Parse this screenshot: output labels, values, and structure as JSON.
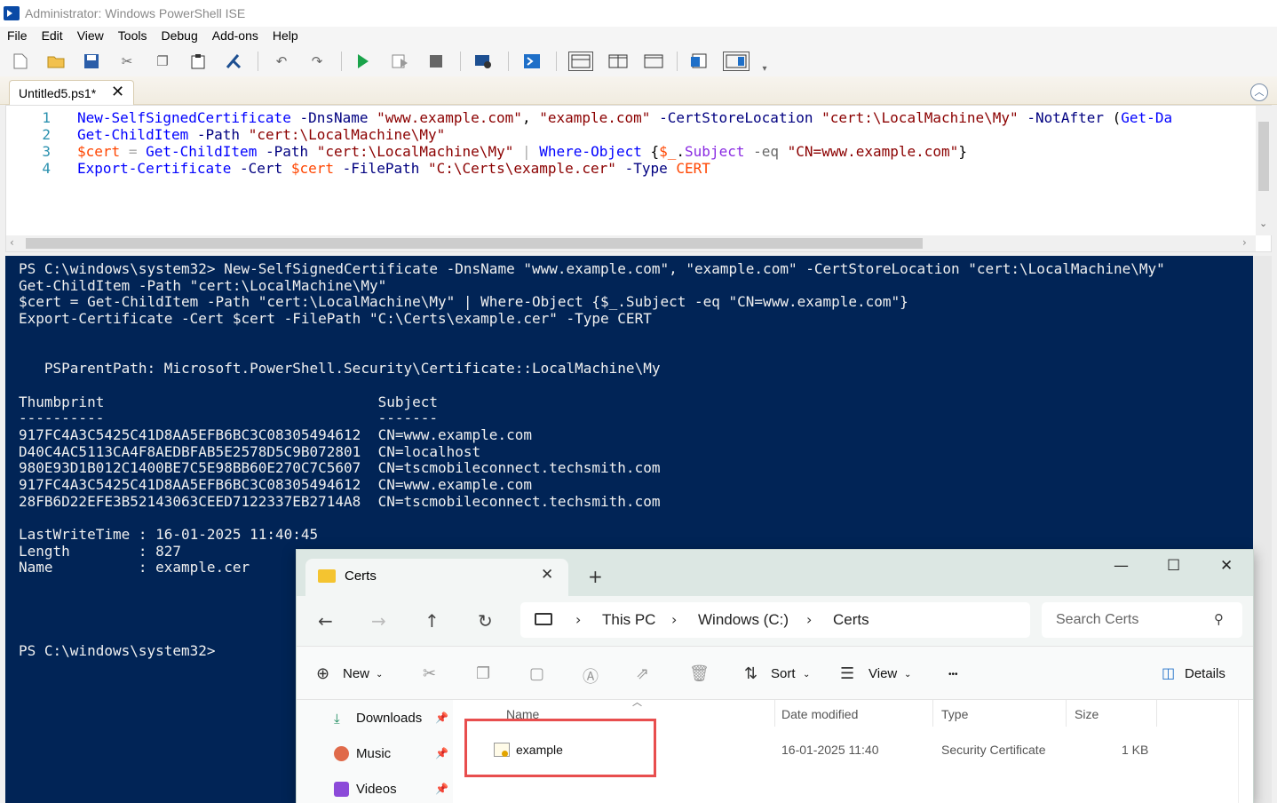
{
  "window": {
    "title": "Administrator: Windows PowerShell ISE"
  },
  "menu": [
    "File",
    "Edit",
    "View",
    "Tools",
    "Debug",
    "Add-ons",
    "Help"
  ],
  "editor": {
    "tab_label": "Untitled5.ps1*",
    "line_numbers": [
      "1",
      "2",
      "3",
      "4"
    ],
    "lines": [
      [
        [
          "cmd",
          "New-SelfSignedCertificate"
        ],
        [
          "plain",
          " "
        ],
        [
          "param",
          "-DnsName"
        ],
        [
          "plain",
          " "
        ],
        [
          "str",
          "\"www.example.com\""
        ],
        [
          "plain",
          ", "
        ],
        [
          "str",
          "\"example.com\""
        ],
        [
          "plain",
          " "
        ],
        [
          "param",
          "-CertStoreLocation"
        ],
        [
          "plain",
          " "
        ],
        [
          "str",
          "\"cert:\\LocalMachine\\My\""
        ],
        [
          "plain",
          " "
        ],
        [
          "param",
          "-NotAfter"
        ],
        [
          "plain",
          " ("
        ],
        [
          "cmd",
          "Get-Da"
        ]
      ],
      [
        [
          "cmd",
          "Get-ChildItem"
        ],
        [
          "plain",
          " "
        ],
        [
          "param",
          "-Path"
        ],
        [
          "plain",
          " "
        ],
        [
          "str",
          "\"cert:\\LocalMachine\\My\""
        ]
      ],
      [
        [
          "var",
          "$cert"
        ],
        [
          "plain",
          " "
        ],
        [
          "op",
          "="
        ],
        [
          "plain",
          " "
        ],
        [
          "cmd",
          "Get-ChildItem"
        ],
        [
          "plain",
          " "
        ],
        [
          "param",
          "-Path"
        ],
        [
          "plain",
          " "
        ],
        [
          "str",
          "\"cert:\\LocalMachine\\My\""
        ],
        [
          "plain",
          " "
        ],
        [
          "op",
          "|"
        ],
        [
          "plain",
          " "
        ],
        [
          "cmd",
          "Where-Object"
        ],
        [
          "plain",
          " {"
        ],
        [
          "var",
          "$_"
        ],
        [
          "plain",
          "."
        ],
        [
          "text",
          "Subject"
        ],
        [
          "plain",
          " "
        ],
        [
          "gray",
          "-eq"
        ],
        [
          "plain",
          " "
        ],
        [
          "str",
          "\"CN=www.example.com\""
        ],
        [
          "plain",
          "}"
        ]
      ],
      [
        [
          "cmd",
          "Export-Certificate"
        ],
        [
          "plain",
          " "
        ],
        [
          "param",
          "-Cert"
        ],
        [
          "plain",
          " "
        ],
        [
          "var",
          "$cert"
        ],
        [
          "plain",
          " "
        ],
        [
          "param",
          "-FilePath"
        ],
        [
          "plain",
          " "
        ],
        [
          "str",
          "\"C:\\Certs\\example.cer\""
        ],
        [
          "plain",
          " "
        ],
        [
          "param",
          "-Type"
        ],
        [
          "plain",
          " "
        ],
        [
          "var",
          "CERT"
        ]
      ]
    ]
  },
  "console": {
    "lines": [
      "PS C:\\windows\\system32> New-SelfSignedCertificate -DnsName \"www.example.com\", \"example.com\" -CertStoreLocation \"cert:\\LocalMachine\\My\"",
      "Get-ChildItem -Path \"cert:\\LocalMachine\\My\"",
      "$cert = Get-ChildItem -Path \"cert:\\LocalMachine\\My\" | Where-Object {$_.Subject -eq \"CN=www.example.com\"}",
      "Export-Certificate -Cert $cert -FilePath \"C:\\Certs\\example.cer\" -Type CERT",
      "",
      "",
      "   PSParentPath: Microsoft.PowerShell.Security\\Certificate::LocalMachine\\My",
      "",
      "Thumbprint                                Subject",
      "----------                                -------",
      "917FC4A3C5425C41D8AA5EFB6BC3C08305494612  CN=www.example.com",
      "D40C4AC5113CA4F8AEDBFAB5E2578D5C9B072801  CN=localhost",
      "980E93D1B012C1400BE7C5E98BB60E270C7C5607  CN=tscmobileconnect.techsmith.com",
      "917FC4A3C5425C41D8AA5EFB6BC3C08305494612  CN=www.example.com",
      "28FB6D22EFE3B52143063CEED7122337EB2714A8  CN=tscmobileconnect.techsmith.com",
      "",
      "LastWriteTime : 16-01-2025 11:40:45",
      "Length        : 827",
      "Name          : example.cer",
      "",
      "",
      "",
      "",
      "PS C:\\windows\\system32>"
    ]
  },
  "explorer": {
    "tab_title": "Certs",
    "window_controls": {
      "minimize": "—",
      "maximize": "☐",
      "close": "✕"
    },
    "breadcrumb": [
      "This PC",
      "Windows (C:)",
      "Certs"
    ],
    "search_placeholder": "Search Certs",
    "commands": {
      "new": "New",
      "sort": "Sort",
      "view": "View",
      "more": "•••",
      "details": "Details"
    },
    "nav_items": [
      "Downloads",
      "Music",
      "Videos"
    ],
    "columns": [
      "Name",
      "Date modified",
      "Type",
      "Size"
    ],
    "files": [
      {
        "name": "example",
        "date": "16-01-2025 11:40",
        "type": "Security Certificate",
        "size": "1 KB"
      }
    ]
  },
  "colors": {
    "console_bg": "#012456",
    "highlight": "#e84e4e"
  }
}
